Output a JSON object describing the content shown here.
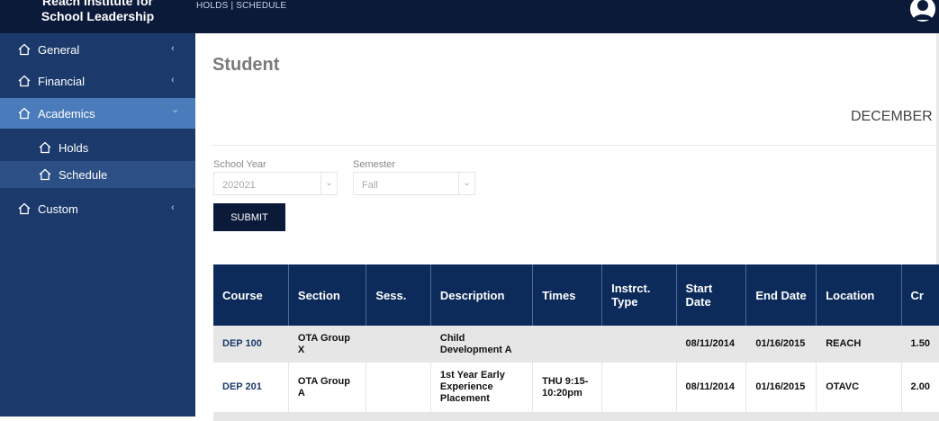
{
  "app": {
    "logo_line1": "Reach Institute for",
    "logo_line2": "School Leadership",
    "topnav": {
      "holds": "HOLDS",
      "separator": "|",
      "schedule": "SCHEDULE"
    }
  },
  "sidebar": {
    "items": [
      {
        "label": "General",
        "chevron": "‹"
      },
      {
        "label": "Financial",
        "chevron": "‹"
      },
      {
        "label": "Academics",
        "chevron": "⌄"
      },
      {
        "label": "Custom",
        "chevron": "‹"
      }
    ],
    "subitems": [
      {
        "label": "Holds"
      },
      {
        "label": "Schedule"
      }
    ]
  },
  "main": {
    "title": "Student",
    "date": "DECEMBER",
    "filters": {
      "school_year_label": "School Year",
      "school_year_value": "202021",
      "semester_label": "Semester",
      "semester_value": "Fall"
    },
    "submit_label": "SUBMIT"
  },
  "table": {
    "headers": [
      "Course",
      "Section",
      "Sess.",
      "Description",
      "Times",
      "Instrct. Type",
      "Start Date",
      "End Date",
      "Location",
      "Cr"
    ],
    "rows": [
      [
        "DEP 100",
        "OTA Group X",
        "",
        "Child Development A",
        "",
        "",
        "08/11/2014",
        "01/16/2015",
        "REACH",
        "1.50"
      ],
      [
        "DEP 201",
        "OTA Group A",
        "",
        "1st Year Early Experience Placement",
        "THU 9:15-10:20pm",
        "",
        "08/11/2014",
        "01/16/2015",
        "OTAVC",
        "2.00"
      ]
    ]
  },
  "colors": {
    "header_bg": "#0c1a3a",
    "sidebar_bg": "#1b3a6b",
    "active_item": "#4a7bbb",
    "table_header": "#0c2a5a"
  }
}
